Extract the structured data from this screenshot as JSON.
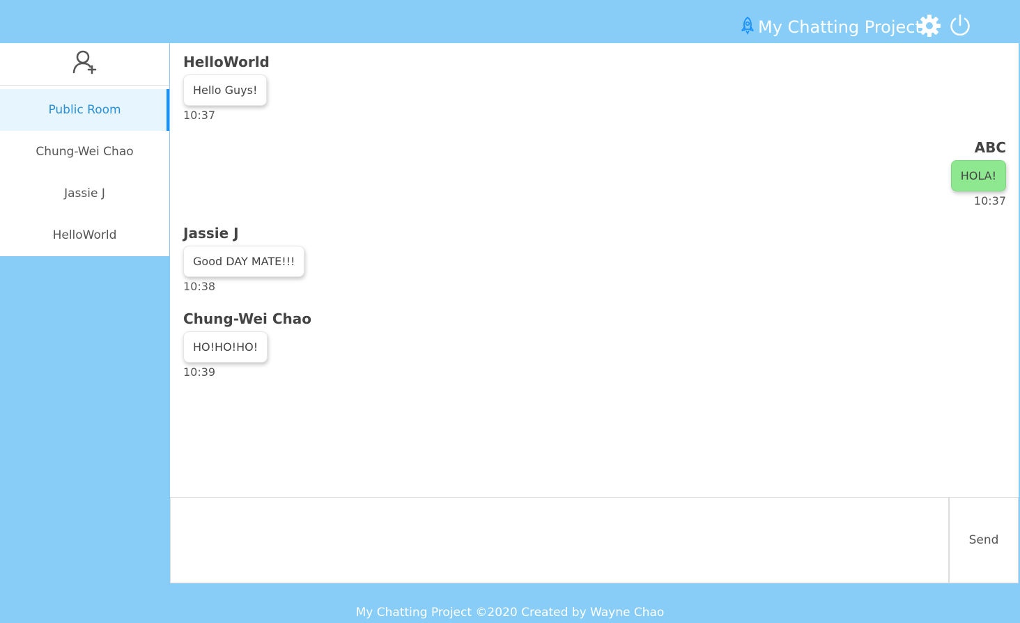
{
  "header": {
    "title": "My Chatting Project",
    "icons": [
      "rocket-icon",
      "gear-icon",
      "power-icon"
    ]
  },
  "sidebar": {
    "add_icon": "add-user-icon",
    "rooms": [
      {
        "label": "Public Room",
        "active": true
      },
      {
        "label": "Chung-Wei Chao",
        "active": false
      },
      {
        "label": "Jassie J",
        "active": false
      },
      {
        "label": "HelloWorld",
        "active": false
      }
    ]
  },
  "messages": [
    {
      "sender": "HelloWorld",
      "text": "Hello Guys!",
      "time": "10:37",
      "side": "left"
    },
    {
      "sender": "ABC",
      "text": "HOLA!",
      "time": "10:37",
      "side": "right"
    },
    {
      "sender": "Jassie J",
      "text": "Good DAY MATE!!!",
      "time": "10:38",
      "side": "left"
    },
    {
      "sender": "Chung-Wei Chao",
      "text": "HO!HO!HO!",
      "time": "10:39",
      "side": "left"
    }
  ],
  "composer": {
    "value": "",
    "send_label": "Send"
  },
  "footer": {
    "text": "My Chatting Project ©2020 Created by Wayne Chao"
  },
  "colors": {
    "background": "#87cdf8",
    "accent": "#1890ff",
    "own_bubble": "#8ee88f"
  }
}
